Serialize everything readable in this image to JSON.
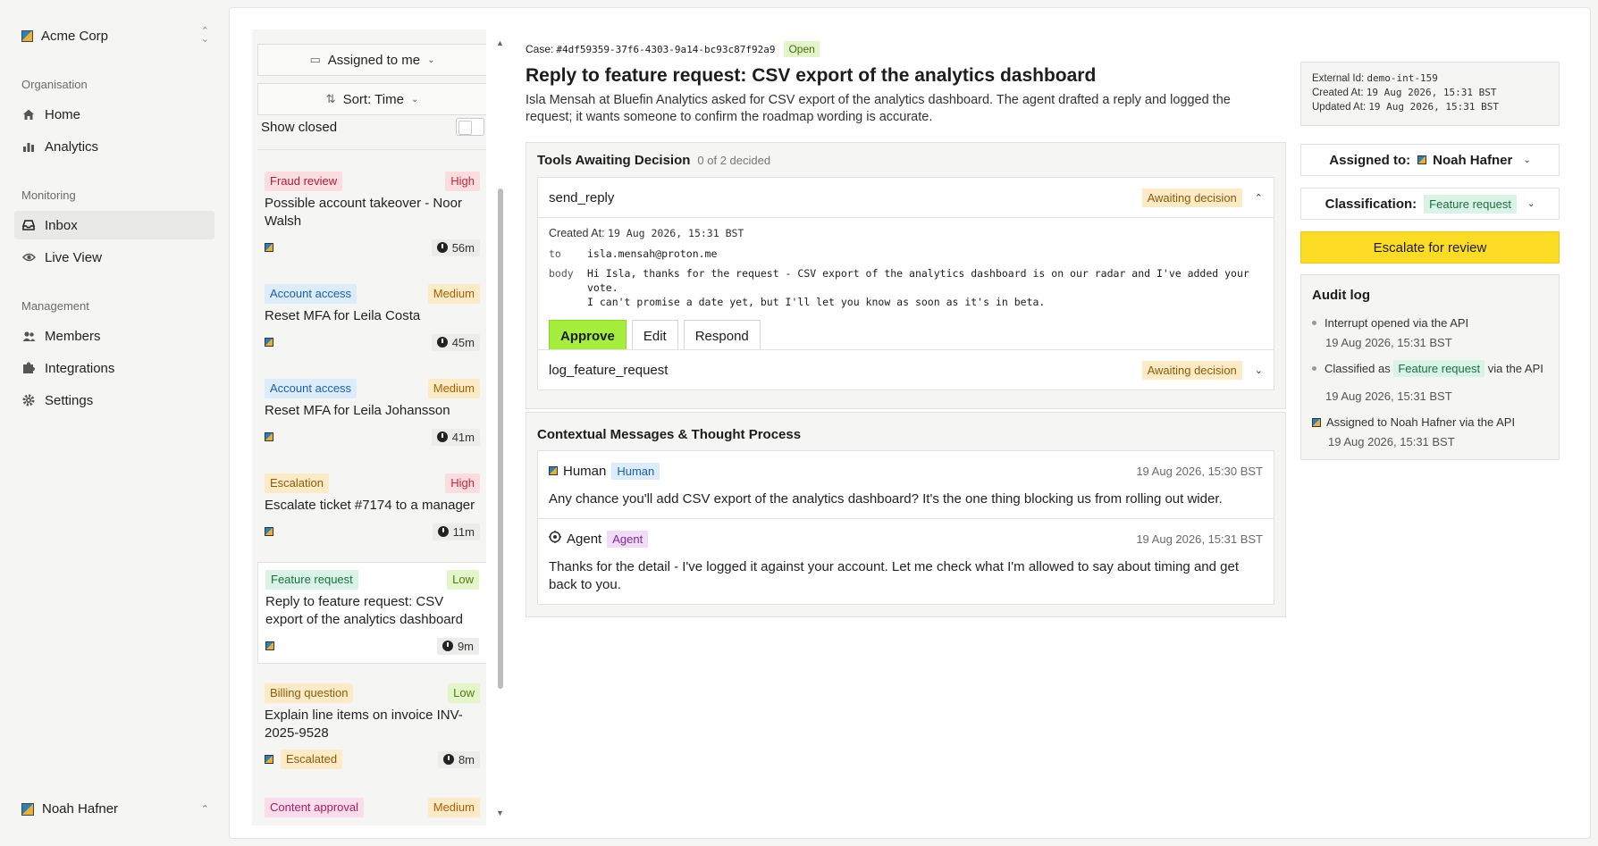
{
  "org": {
    "name": "Acme Corp"
  },
  "nav": {
    "sections": [
      {
        "title": "Organisation",
        "items": [
          "Home",
          "Analytics"
        ]
      },
      {
        "title": "Monitoring",
        "items": [
          "Inbox",
          "Live View"
        ]
      },
      {
        "title": "Management",
        "items": [
          "Members",
          "Integrations",
          "Settings"
        ]
      }
    ],
    "active": "Inbox"
  },
  "user": {
    "name": "Noah Hafner"
  },
  "inbox": {
    "assigned_filter": "Assigned to me",
    "sort": "Sort: Time",
    "show_closed": "Show closed",
    "cards": [
      {
        "category": "Fraud review",
        "priority": "High",
        "title": "Possible account takeover - Noor Walsh",
        "time": "56m",
        "extra": ""
      },
      {
        "category": "Account access",
        "priority": "Medium",
        "title": "Reset MFA for Leila Costa",
        "time": "45m",
        "extra": ""
      },
      {
        "category": "Account access",
        "priority": "Medium",
        "title": "Reset MFA for Leila Johansson",
        "time": "41m",
        "extra": ""
      },
      {
        "category": "Escalation",
        "priority": "High",
        "title": "Escalate ticket #7174 to a manager",
        "time": "11m",
        "extra": ""
      },
      {
        "category": "Feature request",
        "priority": "Low",
        "title": "Reply to feature request: CSV export of the analytics dashboard",
        "time": "9m",
        "extra": ""
      },
      {
        "category": "Billing question",
        "priority": "Low",
        "title": "Explain line items on invoice INV-2025-9528",
        "time": "8m",
        "extra": "Escalated"
      },
      {
        "category": "Content approval",
        "priority": "Medium",
        "title": "",
        "time": "",
        "extra": ""
      }
    ]
  },
  "case": {
    "id_label": "Case:",
    "id": "#4df59359-37f6-4303-9a14-bc93c87f92a9",
    "status": "Open",
    "title": "Reply to feature request: CSV export of the analytics dashboard",
    "description": "Isla Mensah at Bluefin Analytics asked for CSV export of the analytics dashboard. The agent drafted a reply and logged the request; it wants someone to confirm the roadmap wording is accurate."
  },
  "tools": {
    "heading": "Tools Awaiting Decision",
    "progress": "0 of 2 decided",
    "items": [
      {
        "name": "send_reply",
        "status": "Awaiting decision",
        "created_label": "Created At:",
        "created": "19 Aug 2026, 15:31 BST",
        "to_label": "to",
        "to": "isla.mensah@proton.me",
        "body_label": "body",
        "body_line1": "Hi Isla, thanks for the request - CSV export of the analytics dashboard is on our radar and I've added your vote.",
        "body_line2": "I can't promise a date yet, but I'll let you know as soon as it's in beta.",
        "approve": "Approve",
        "edit": "Edit",
        "respond": "Respond"
      },
      {
        "name": "log_feature_request",
        "status": "Awaiting decision"
      }
    ]
  },
  "messages": {
    "heading": "Contextual Messages & Thought Process",
    "items": [
      {
        "sender": "Human",
        "role": "Human",
        "time": "19 Aug 2026, 15:30 BST",
        "text": "Any chance you'll add CSV export of the analytics dashboard? It's the one thing blocking us from rolling out wider."
      },
      {
        "sender": "Agent",
        "role": "Agent",
        "time": "19 Aug 2026, 15:31 BST",
        "text": "Thanks for the detail - I've logged it against your account. Let me check what I'm allowed to say about timing and get back to you."
      }
    ]
  },
  "meta": {
    "external_label": "External Id:",
    "external_id": "demo-int-159",
    "created_label": "Created At:",
    "created": "19 Aug 2026, 15:31 BST",
    "updated_label": "Updated At:",
    "updated": "19 Aug 2026, 15:31 BST"
  },
  "assignment": {
    "label": "Assigned to:",
    "value": "Noah Hafner"
  },
  "classification": {
    "label": "Classification:",
    "value": "Feature request"
  },
  "escalate_label": "Escalate for review",
  "audit": {
    "heading": "Audit log",
    "events": [
      {
        "text": "Interrupt opened via the API",
        "time": "19 Aug 2026, 15:31 BST"
      },
      {
        "pre": "Classified as",
        "tag": "Feature request",
        "post": "via the API",
        "time": "19 Aug 2026, 15:31 BST"
      },
      {
        "pre": "Assigned to",
        "who": "Noah Hafner",
        "post": "via the API",
        "time": "19 Aug 2026, 15:31 BST"
      }
    ]
  },
  "colors": {
    "accent_yellow": "#fcdc25",
    "approve_green": "#a6ee3e",
    "priority_high": "#c8283c",
    "priority_medium": "#a85f00",
    "priority_low": "#4e7a12"
  }
}
